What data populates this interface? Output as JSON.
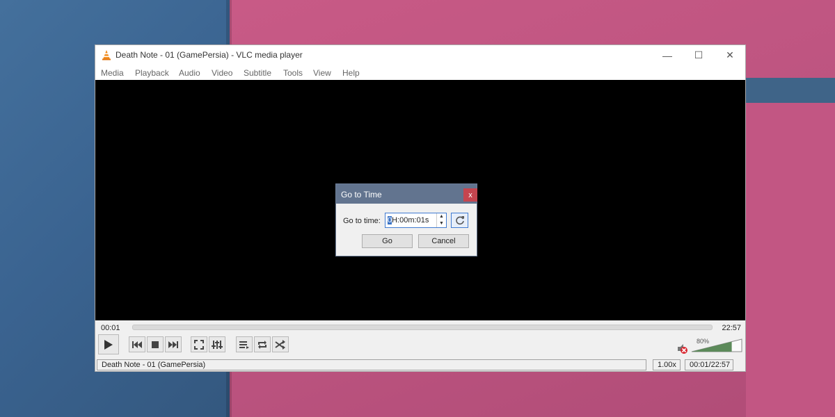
{
  "window": {
    "title": "Death Note - 01 (GamePersia) - VLC media player",
    "minimize_glyph": "—",
    "maximize_glyph": "☐",
    "close_glyph": "✕"
  },
  "menu": [
    "Media",
    "Playback",
    "Audio",
    "Video",
    "Subtitle",
    "Tools",
    "View",
    "Help"
  ],
  "player": {
    "elapsed": "00:01",
    "total": "22:57",
    "progress": 0.001,
    "volume_percent": "80%",
    "volume_level": 0.8,
    "muted": true
  },
  "status": {
    "media_name": "Death Note - 01 (GamePersia)",
    "speed": "1.00x",
    "time": "00:01/22:57"
  },
  "dialog": {
    "title": "Go to Time",
    "close_glyph": "x",
    "label": "Go to time:",
    "value_selected": "0",
    "value_rest": "H:00m:01s",
    "go_label": "Go",
    "cancel_label": "Cancel"
  },
  "icons": [
    "vlc-cone-icon",
    "play-icon",
    "previous-icon",
    "stop-icon",
    "next-icon",
    "fullscreen-icon",
    "extended-settings-icon",
    "playlist-icon",
    "loop-icon",
    "shuffle-icon",
    "mute-icon",
    "reset-icon"
  ],
  "colors": {
    "dialog_title_bg": "#62748f",
    "dialog_close_bg": "#c5454f",
    "volume_fill": "#5c8a5a"
  }
}
